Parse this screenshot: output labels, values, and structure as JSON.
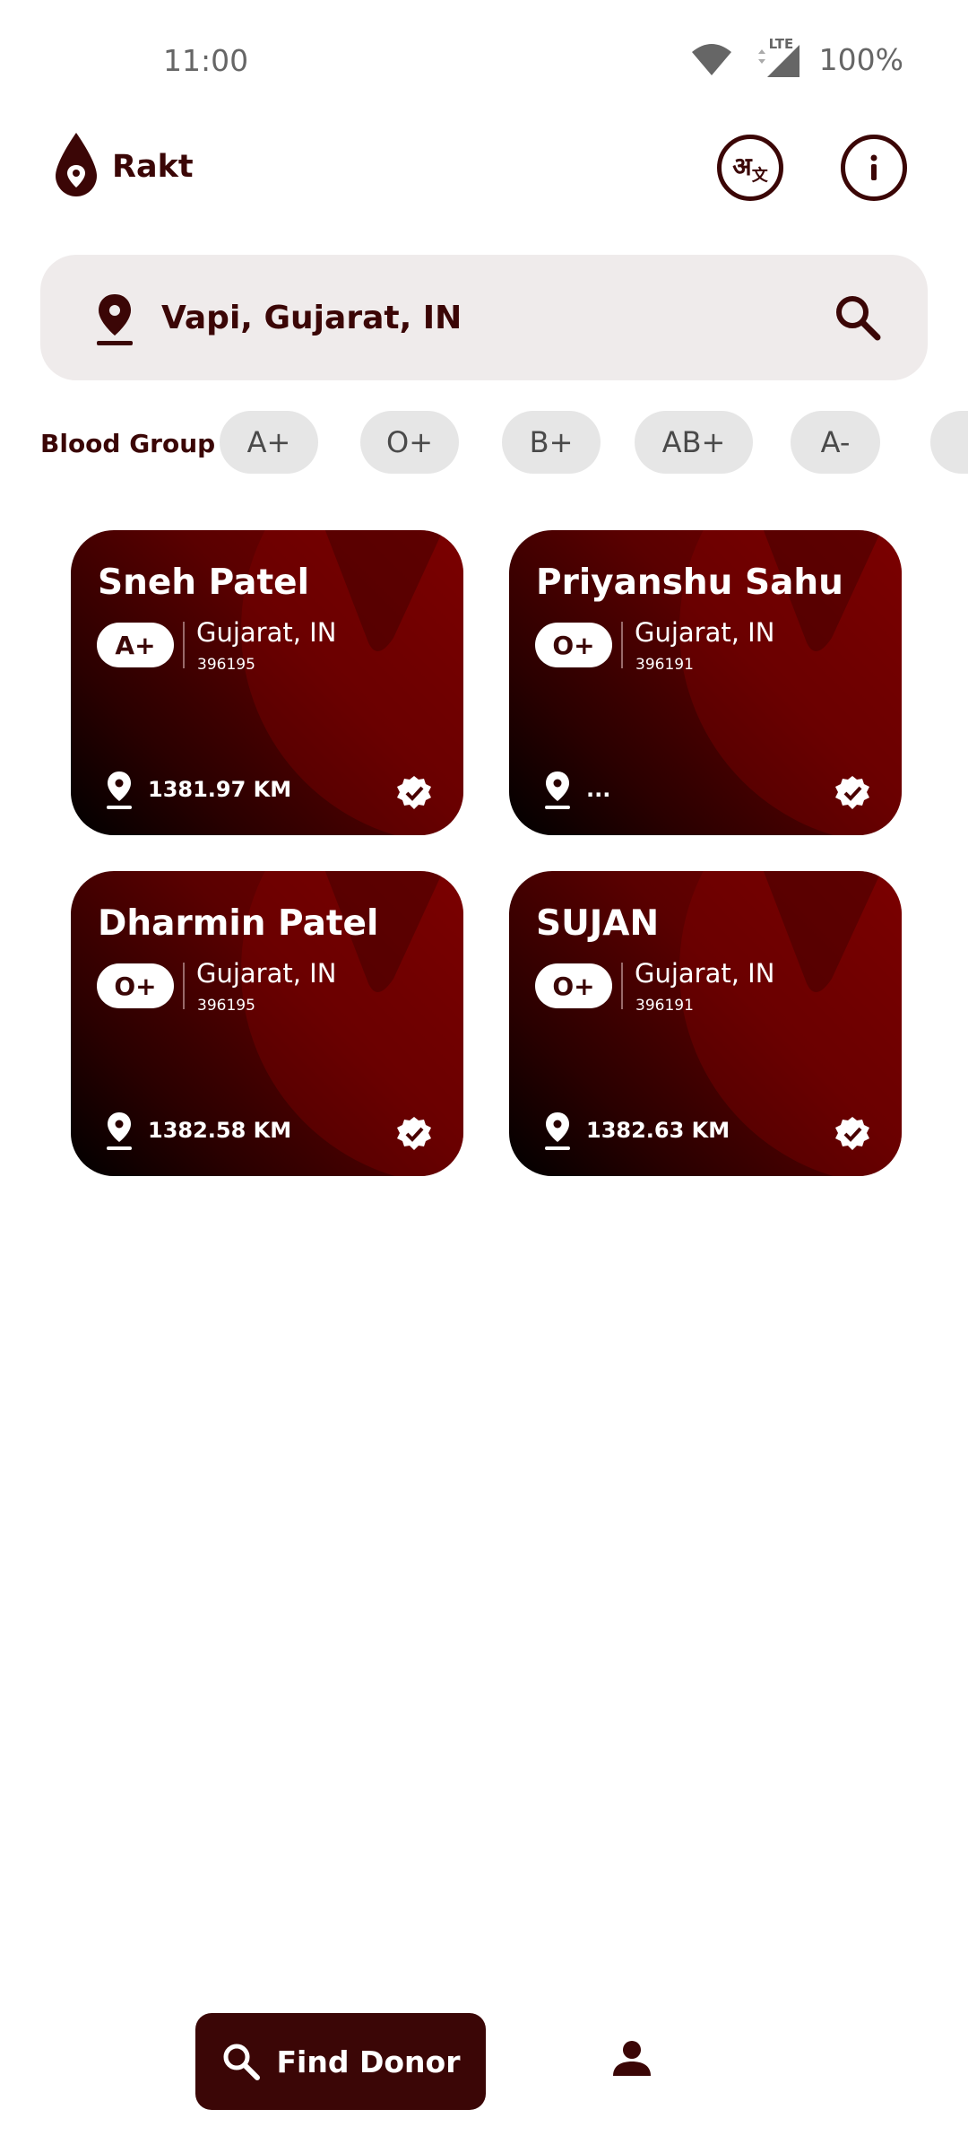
{
  "status_bar": {
    "time": "11:00",
    "battery": "100%",
    "network": "LTE"
  },
  "app": {
    "title": "Rakt"
  },
  "search": {
    "value": "Vapi, Gujarat, IN"
  },
  "filters": {
    "label": "Blood Group",
    "chips": [
      "A+",
      "O+",
      "B+",
      "AB+",
      "A-"
    ]
  },
  "donors": [
    {
      "name": "Sneh Patel",
      "blood_group": "A+",
      "state": "Gujarat, IN",
      "pincode": "396195",
      "distance": "1381.97 KM"
    },
    {
      "name": "Priyanshu Sahu",
      "blood_group": "O+",
      "state": "Gujarat, IN",
      "pincode": "396191",
      "distance": "..."
    },
    {
      "name": "Dharmin Patel",
      "blood_group": "O+",
      "state": "Gujarat, IN",
      "pincode": "396195",
      "distance": "1382.58 KM"
    },
    {
      "name": "SUJAN",
      "blood_group": "O+",
      "state": "Gujarat, IN",
      "pincode": "396191",
      "distance": "1382.63 KM"
    }
  ],
  "bottom_nav": {
    "find_donor_label": "Find Donor"
  },
  "colors": {
    "brand": "#3b0606",
    "card_dark": "#000000",
    "card_light": "#730000",
    "search_bg": "#efebeb",
    "chip_bg": "#e6e6e6"
  },
  "icons": [
    "location-pin-icon",
    "translate-icon",
    "info-icon",
    "search-icon",
    "verified-icon",
    "profile-icon",
    "wifi-icon",
    "cell-signal-icon",
    "blood-drop-icon"
  ]
}
